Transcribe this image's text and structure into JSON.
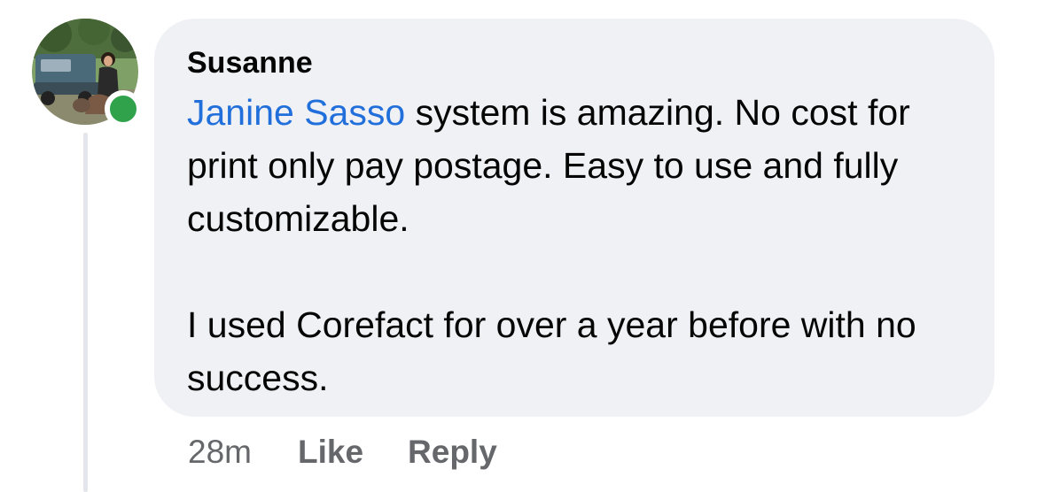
{
  "comment": {
    "author": "Susanne",
    "mention": "Janine Sasso",
    "line1_rest": " system is amazing. No cost for print only pay postage. Easy to use and fully customizable.",
    "paragraph2": "I used Corefact for over a year before with no success.",
    "timestamp": "28m",
    "like_label": "Like",
    "reply_label": "Reply",
    "online": true
  },
  "colors": {
    "bubble": "#f0f1f5",
    "mention": "#216fdb",
    "presence": "#31a24c",
    "secondary_text": "#65676b"
  },
  "icons": {
    "presence": "online-status-dot-icon"
  }
}
